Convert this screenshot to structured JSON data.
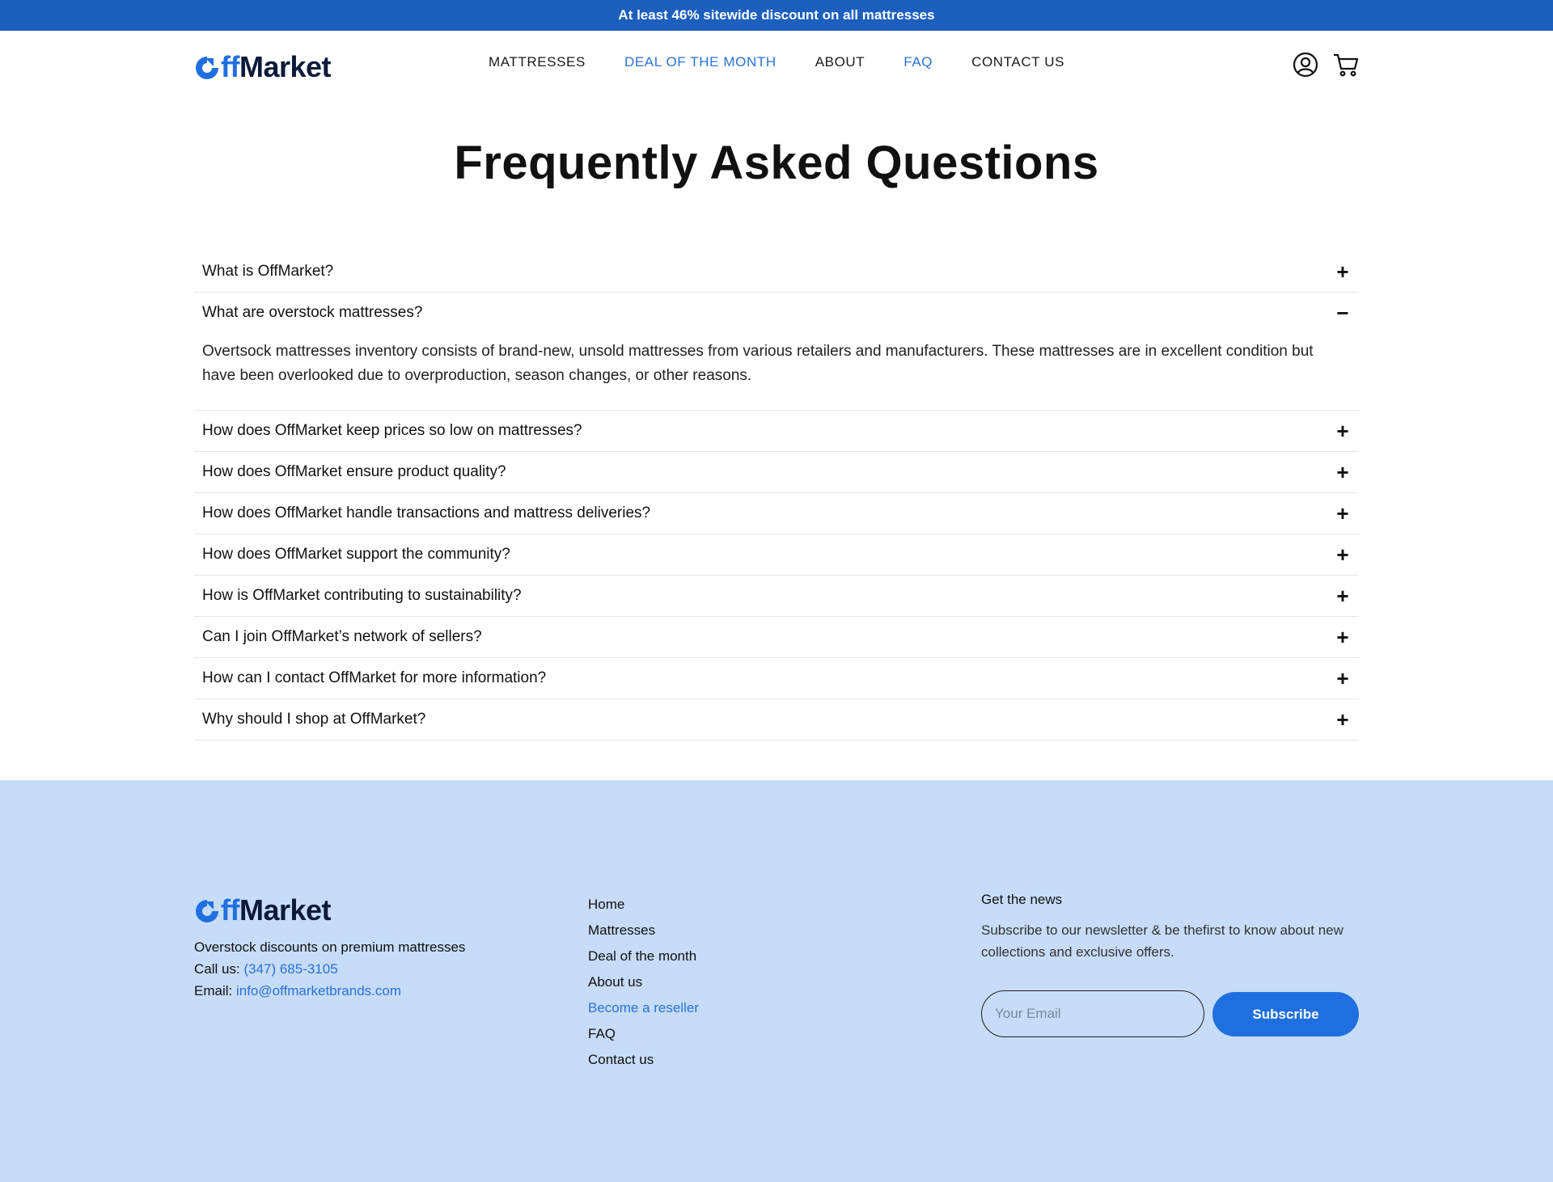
{
  "announcement": "At least  46% sitewide discount on all mattresses",
  "logo": {
    "prefix": "ff",
    "suffix": "Market"
  },
  "nav": {
    "items": [
      {
        "label": "MATTRESSES",
        "active": false
      },
      {
        "label": "DEAL OF THE MONTH",
        "active": true
      },
      {
        "label": "ABOUT",
        "active": false
      },
      {
        "label": "FAQ",
        "active": true
      },
      {
        "label": "CONTACT US",
        "active": false
      }
    ],
    "icons": [
      "user-account-icon",
      "cart-icon"
    ]
  },
  "page_title": "Frequently Asked Questions",
  "faq": {
    "items": [
      {
        "question": "What is OffMarket?",
        "icon": "plus-icon"
      },
      {
        "question": "What are overstock mattresses?",
        "icon": "minus-icon",
        "answer": "Overtsock mattresses inventory consists of brand-new, unsold mattresses from various retailers and manufacturers. These mattresses are in excellent condition but have been overlooked due to overproduction, season changes, or other reasons."
      },
      {
        "question": "How does OffMarket keep prices so low on mattresses?",
        "icon": "plus-icon"
      },
      {
        "question": "How does OffMarket ensure product quality?",
        "icon": "plus-icon"
      },
      {
        "question": "How does OffMarket handle transactions and mattress deliveries?",
        "icon": "plus-icon"
      },
      {
        "question": "How does OffMarket support the community?",
        "icon": "plus-icon"
      },
      {
        "question": "How is OffMarket contributing to sustainability?",
        "icon": "plus-icon"
      },
      {
        "question": "Can I join OffMarket’s network of sellers?",
        "icon": "plus-icon"
      },
      {
        "question": "How can I contact OffMarket for more information?",
        "icon": "plus-icon"
      },
      {
        "question": "Why should I shop at OffMarket?",
        "icon": "plus-icon"
      }
    ]
  },
  "footer": {
    "tagline": "Overstock discounts on premium mattresses",
    "call_label": "Call us:",
    "phone": "(347) 685-3105",
    "email_label": "Email:",
    "email": "info@offmarketbrands.com",
    "links": [
      {
        "label": "Home",
        "highlight": false
      },
      {
        "label": "Mattresses",
        "highlight": false
      },
      {
        "label": "Deal of the month",
        "highlight": false
      },
      {
        "label": "About us",
        "highlight": false
      },
      {
        "label": "Become a reseller",
        "highlight": true
      },
      {
        "label": "FAQ",
        "highlight": false
      },
      {
        "label": "Contact us",
        "highlight": false
      }
    ],
    "news_heading": "Get the news",
    "news_text": "Subscribe to our newsletter & be thefirst to know about new collections and exclusive offers.",
    "email_placeholder": "Your Email",
    "subscribe_label": "Subscribe"
  },
  "colors": {
    "brand_blue": "#1f6fe0",
    "banner_blue": "#1c5fbd",
    "footer_bg": "#c6dcf8",
    "link_blue": "#2a72d8"
  }
}
